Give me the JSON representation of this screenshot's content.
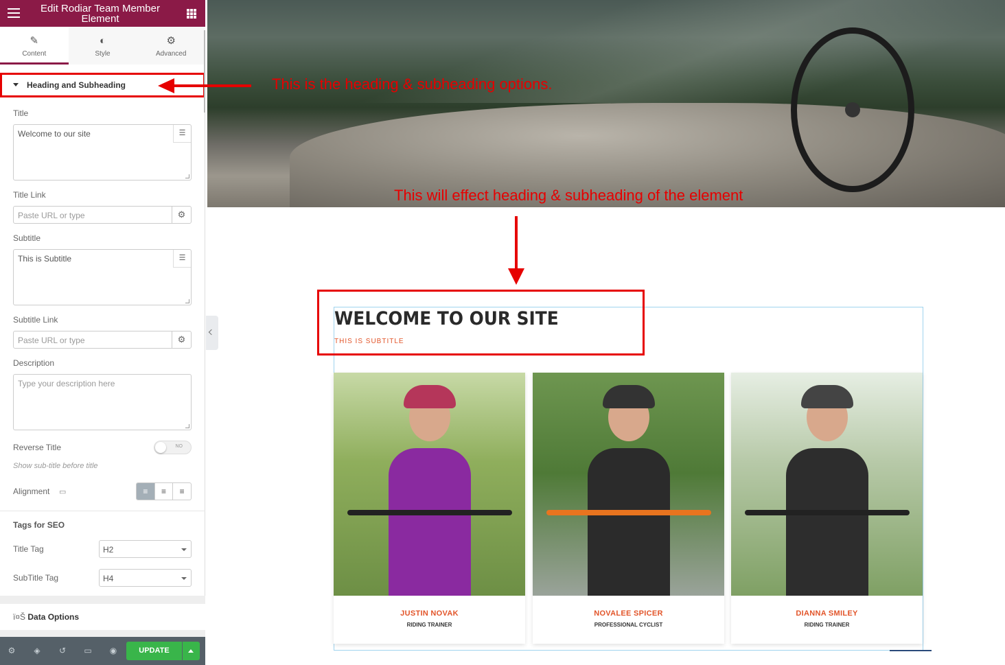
{
  "panel": {
    "header_title": "Edit Rodiar Team Member Element",
    "tabs": [
      {
        "label": "Content",
        "icon": "pencil-icon"
      },
      {
        "label": "Style",
        "icon": "contrast-icon"
      },
      {
        "label": "Advanced",
        "icon": "gear-icon"
      }
    ],
    "section_title": "Heading and Subheading",
    "fields": {
      "title_label": "Title",
      "title_value": "Welcome to our site",
      "title_link_label": "Title Link",
      "title_link_placeholder": "Paste URL or type",
      "subtitle_label": "Subtitle",
      "subtitle_value": "This is Subtitle",
      "subtitle_link_label": "Subtitle Link",
      "subtitle_link_placeholder": "Paste URL or type",
      "description_label": "Description",
      "description_placeholder": "Type your description here",
      "reverse_title_label": "Reverse Title",
      "reverse_toggle_text": "NO",
      "reverse_note": "Show sub-title before title",
      "alignment_label": "Alignment"
    },
    "seo": {
      "heading": "Tags for SEO",
      "title_tag_label": "Title Tag",
      "title_tag_value": "H2",
      "subtitle_tag_label": "SubTitle Tag",
      "subtitle_tag_value": "H4"
    },
    "data_options_prefix": "ï¤Š",
    "data_options_title": "Data Options",
    "footer": {
      "update_label": "UPDATE",
      "icons": [
        "settings-icon",
        "layers-icon",
        "history-icon",
        "responsive-icon",
        "preview-eye-icon"
      ]
    }
  },
  "annotations": {
    "heading_options": "This is the heading & subheading options.",
    "effect_note": "This will effect heading & subheading of the element"
  },
  "preview": {
    "title": "WELCOME TO OUR SITE",
    "subtitle": "THIS IS SUBTITLE",
    "members": [
      {
        "name": "JUSTIN NOVAK",
        "role": "RIDING TRAINER"
      },
      {
        "name": "NOVALEE SPICER",
        "role": "PROFESSIONAL CYCLIST"
      },
      {
        "name": "DIANNA SMILEY",
        "role": "RIDING TRAINER"
      }
    ]
  },
  "colors": {
    "brand": "#8b1a47",
    "annotation_red": "#e60000",
    "accent_orange": "#e2552a",
    "update_green": "#39b54a",
    "footer_bg": "#556068"
  }
}
